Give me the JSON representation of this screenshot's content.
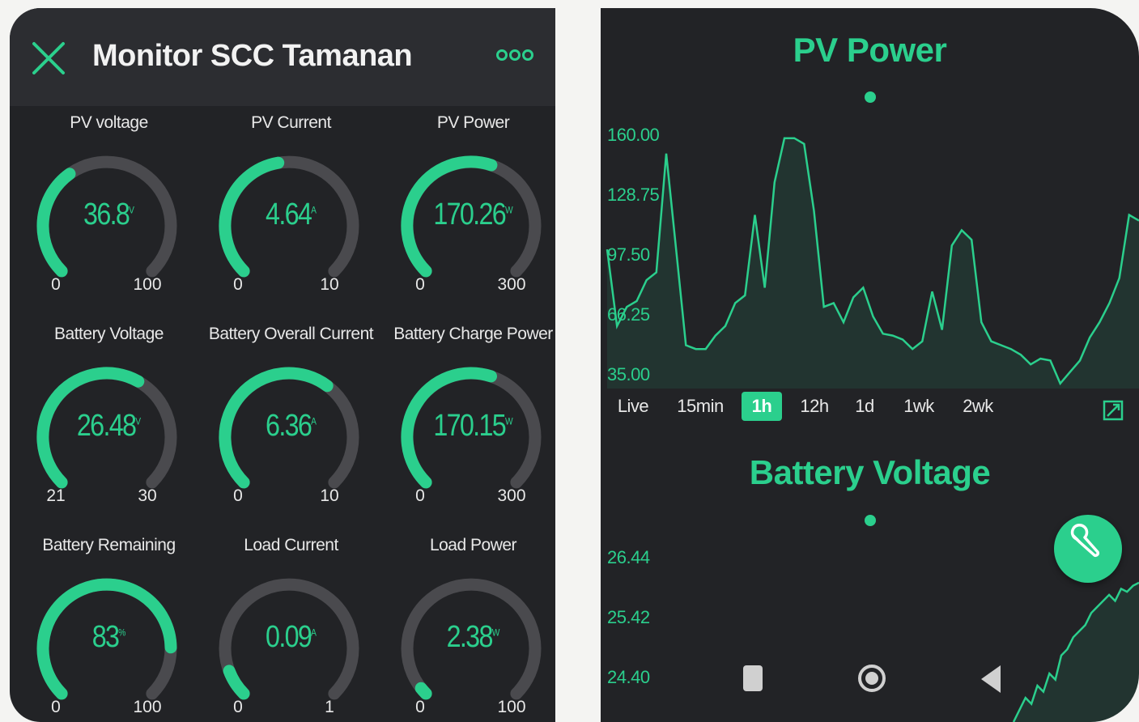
{
  "header": {
    "title": "Monitor SCC Tamanan",
    "close_icon": "close-icon",
    "more_icon": "more-options-icon"
  },
  "colors": {
    "accent": "#2bcf8d",
    "background": "#222326",
    "header": "#2c2d31",
    "gauge_track": "#4a4a4e",
    "text": "#e8e8e8"
  },
  "gauges": [
    {
      "label": "PV voltage",
      "value": "36.8",
      "unit": "V",
      "min": "0",
      "max": "100",
      "level": 0.368
    },
    {
      "label": "PV Current",
      "value": "4.64",
      "unit": "A",
      "min": "0",
      "max": "10",
      "level": 0.464
    },
    {
      "label": "PV Power",
      "value": "170.26",
      "unit": "W",
      "min": "0",
      "max": "300",
      "level": 0.568
    },
    {
      "label": "Battery Voltage",
      "value": "26.48",
      "unit": "V",
      "min": "21",
      "max": "30",
      "level": 0.609
    },
    {
      "label": "Battery Overall Current",
      "value": "6.36",
      "unit": "A",
      "min": "0",
      "max": "10",
      "level": 0.636
    },
    {
      "label": "Battery Charge Power",
      "value": "170.15",
      "unit": "W",
      "min": "0",
      "max": "300",
      "level": 0.567
    },
    {
      "label": "Battery Remaining",
      "value": "83",
      "unit": "%",
      "min": "0",
      "max": "100",
      "level": 0.83
    },
    {
      "label": "Load Current",
      "value": "0.09",
      "unit": "A",
      "min": "0",
      "max": "1",
      "level": 0.09
    },
    {
      "label": "Load Power",
      "value": "2.38",
      "unit": "W",
      "min": "0",
      "max": "100",
      "level": 0.0238
    }
  ],
  "pv_chart": {
    "title": "PV Power",
    "y_ticks": [
      "160.00",
      "128.75",
      "97.50",
      "66.25",
      "35.00"
    ],
    "ylim": [
      35,
      160
    ],
    "values": [
      100,
      60,
      70,
      73,
      84,
      88,
      150,
      100,
      50,
      48,
      48,
      55,
      60,
      72,
      76,
      118,
      80,
      135,
      158,
      158,
      155,
      120,
      70,
      72,
      62,
      75,
      80,
      65,
      56,
      55,
      53,
      48,
      52,
      78,
      58,
      102,
      110,
      105,
      62,
      52,
      50,
      48,
      45,
      40,
      43,
      42,
      30,
      36,
      42,
      54,
      62,
      72,
      85,
      118,
      115
    ]
  },
  "time_ranges": {
    "items": [
      "Live",
      "15min",
      "1h",
      "12h",
      "1d",
      "1wk",
      "2wk"
    ],
    "active": "1h"
  },
  "battery_chart": {
    "title": "Battery Voltage",
    "y_ticks": [
      "26.44",
      "25.42",
      "24.40"
    ],
    "ylim": [
      24.0,
      26.7
    ],
    "values": [
      24.0,
      24.2,
      24.4,
      24.3,
      24.6,
      24.5,
      24.8,
      24.7,
      25.1,
      25.2,
      25.4,
      25.5,
      25.6,
      25.8,
      25.9,
      26.0,
      26.1,
      26.0,
      26.2,
      26.15,
      26.25,
      26.3
    ]
  },
  "icons": {
    "fab": "wrench-icon",
    "expand": "expand-icon",
    "nav_recent": "recent-apps-icon",
    "nav_home": "home-icon",
    "nav_back": "back-icon"
  }
}
